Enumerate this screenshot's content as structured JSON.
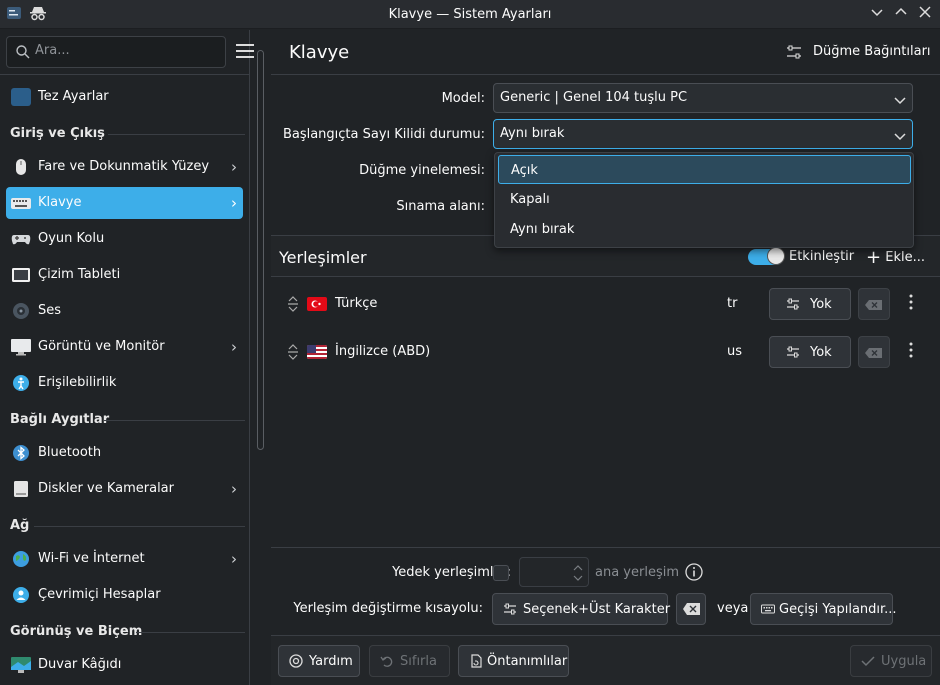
{
  "window": {
    "title": "Klavye — Sistem Ayarları"
  },
  "sidebar": {
    "search_placeholder": "Ara...",
    "items": [
      {
        "label": "Tez Ayarlar"
      },
      {
        "label": "Fare ve Dokunmatik Yüzey"
      },
      {
        "label": "Klavye"
      },
      {
        "label": "Oyun Kolu"
      },
      {
        "label": "Çizim Tableti"
      },
      {
        "label": "Ses"
      },
      {
        "label": "Görüntü ve Monitör"
      },
      {
        "label": "Erişilebilirlik"
      },
      {
        "label": "Bluetooth"
      },
      {
        "label": "Diskler ve Kameralar"
      },
      {
        "label": "Wi-Fi ve İnternet"
      },
      {
        "label": "Çevrimiçi Hesaplar"
      },
      {
        "label": "Duvar Kâğıdı"
      }
    ],
    "sections": {
      "input": "Giriş ve Çıkış",
      "devices": "Bağlı Aygıtlar",
      "network": "Ağ",
      "appearance": "Görünüş ve Biçem"
    }
  },
  "header": {
    "title": "Klavye",
    "bindings_label": "Düğme Bağıntıları"
  },
  "form": {
    "model_label": "Model:",
    "model_value": "Generic | Genel 104 tuşlu PC",
    "numlock_label": "Başlangıçta Sayı Kilidi durumu:",
    "numlock_value": "Aynı bırak",
    "repeat_label": "Düğme yinelemesi:",
    "test_label": "Sınama alanı:"
  },
  "dropdown": {
    "options": [
      "Açık",
      "Kapalı",
      "Aynı bırak"
    ]
  },
  "layouts": {
    "title": "Yerleşimler",
    "enable_label": "Etkinleştir",
    "add_label": "Ekle...",
    "rows": [
      {
        "name": "Türkçe",
        "code": "tr",
        "shortcut": "Yok"
      },
      {
        "name": "İngilizce (ABD)",
        "code": "us",
        "shortcut": "Yok"
      }
    ]
  },
  "spare": {
    "label": "Yedek yerleşimler:",
    "suffix": "ana yerleşim"
  },
  "switch": {
    "label": "Yerleşim değiştirme kısayolu:",
    "shortcut": "Seçenek+Üst Karakter",
    "or": "veya",
    "configure": "Geçişi Yapılandır..."
  },
  "footer": {
    "help": "Yardım",
    "reset": "Sıfırla",
    "defaults": "Öntanımlılar",
    "apply": "Uygula"
  },
  "colors": {
    "accent": "#3daee9",
    "bg": "#202326"
  }
}
